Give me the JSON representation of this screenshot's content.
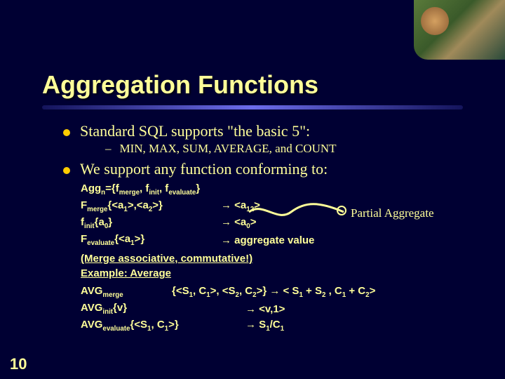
{
  "slide": {
    "title": "Aggregation Functions",
    "bullet1a": "Standard SQL supports \"the basic 5\":",
    "bullet2a": "MIN, MAX, SUM, AVERAGE, and COUNT",
    "bullet1b": "We support any function conforming to:",
    "agg_def": "Agg<sub>n</sub>={f<sub>merge</sub>, f<sub>init</sub>, f<sub>evaluate</sub>}",
    "fmerge_l": "F<sub>merge</sub>{&lt;a<sub>1</sub>&gt;,&lt;a<sub>2</sub>&gt;}",
    "fmerge_r": "→ &lt;a<sub>12</sub>&gt;",
    "finit_l": "f<sub>init</sub>{a<sub>0</sub>}",
    "finit_r": "→ &lt;a<sub>0</sub>&gt;",
    "feval_l": "F<sub>evaluate</sub>{&lt;a<sub>1</sub>&gt;}",
    "feval_r": "→ aggregate value",
    "annotation": "Partial Aggregate",
    "note1": "(Merge associative, commutative!)",
    "note2": "Example: Average",
    "avgm_l": "AVG<sub>merge</sub>",
    "avgm_r": "{&lt;S<sub>1</sub>, C<sub>1</sub>&gt;, &lt;S<sub>2</sub>, C<sub>2</sub>&gt;} → &lt; S<sub>1</sub> + S<sub>2</sub> , C<sub>1</sub> + C<sub>2</sub>&gt;",
    "avgi_l": "AVG<sub>init</sub>{v}",
    "avgi_r": "→ &lt;v,1&gt;",
    "avge_l": "AVG<sub>evaluate</sub>{&lt;S<sub>1</sub>, C<sub>1</sub>&gt;}",
    "avge_r": "→ S<sub>1</sub>/C<sub>1</sub>",
    "page_number": "10"
  }
}
